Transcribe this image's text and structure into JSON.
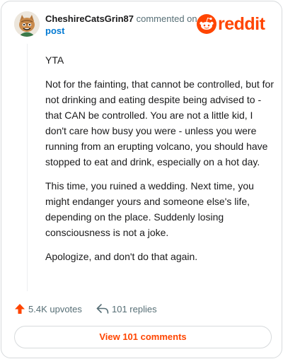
{
  "comment": {
    "username": "CheshireCatsGrin87",
    "commented_on_text": "commented on",
    "post_link_text": "post",
    "paragraphs": [
      "YTA",
      "Not for the fainting, that cannot be controlled, but for not drinking and eating despite being advised to - that CAN be controlled. You are not a little kid, I don't care how busy you were - unless you were running from an erupting volcano, you should have stopped to eat and drink, especially on a hot day.",
      "This time, you ruined a wedding. Next time, you might endanger yours and someone else's life, depending on the place. Suddenly losing consciousness is not a joke.",
      "Apologize, and don't do that again."
    ]
  },
  "brand": {
    "logo_text": "reddit",
    "color": "#ff4500"
  },
  "actions": {
    "upvotes": "5.4K upvotes",
    "replies": "101 replies",
    "upvote_icon": "upvote-arrow-icon",
    "reply_icon": "reply-arrow-icon"
  },
  "footer": {
    "view_comments": "View 101 comments"
  }
}
